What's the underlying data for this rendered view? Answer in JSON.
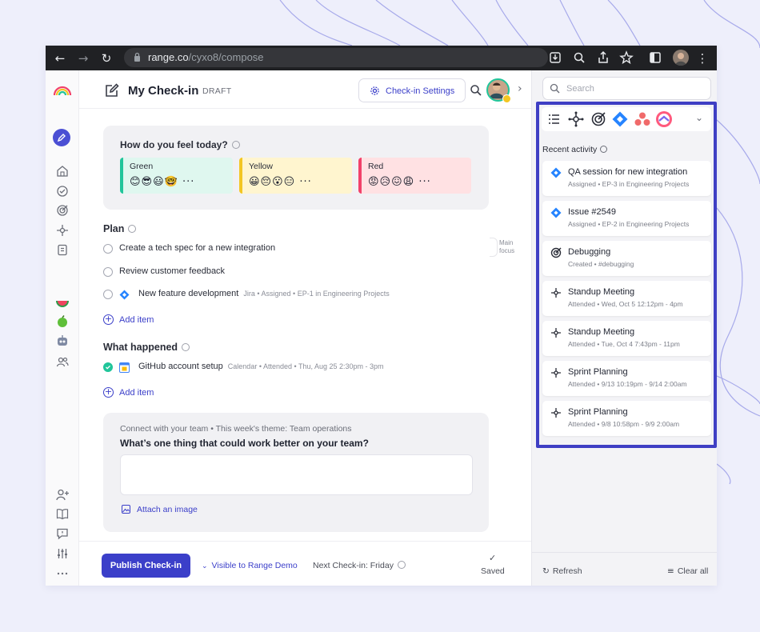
{
  "browser": {
    "url_host": "range.co",
    "url_path": "/cyxo8/compose"
  },
  "header": {
    "title": "My Check-in",
    "status": "DRAFT",
    "settings_label": "Check-in Settings"
  },
  "mood": {
    "question": "How do you feel today?",
    "options": [
      {
        "label": "Green",
        "emojis": "😊😎😃🤓 ···",
        "bg": "#dff7ef",
        "accent": "#21c59a"
      },
      {
        "label": "Yellow",
        "emojis": "😀😔😮😑 ···",
        "bg": "#fff5cf",
        "accent": "#f3c623"
      },
      {
        "label": "Red",
        "emojis": "😡😥😖😩 ···",
        "bg": "#ffe1e3",
        "accent": "#f2416a"
      }
    ]
  },
  "plan": {
    "heading": "Plan",
    "items": [
      {
        "text": "Create a tech spec for a new integration",
        "meta": ""
      },
      {
        "text": "Review customer feedback",
        "meta": ""
      },
      {
        "text": "New feature development",
        "meta": "Jira • Assigned • EP-1 in Engineering Projects"
      }
    ],
    "add_label": "Add item",
    "main_focus_label": "Main focus"
  },
  "happened": {
    "heading": "What happened",
    "items": [
      {
        "text": "GitHub account setup",
        "meta": "Calendar • Attended • Thu, Aug 25 2:30pm - 3pm"
      }
    ],
    "add_label": "Add item"
  },
  "team": {
    "subtitle": "Connect with your team • This week's theme: Team operations",
    "question": "What’s one thing that could work better on your team?",
    "answer": "",
    "attach_label": "Attach an image"
  },
  "footer": {
    "publish_label": "Publish Check-in",
    "visibility_label": "Visible to Range Demo",
    "next_label": "Next Check-in: Friday",
    "saved_label": "Saved"
  },
  "sidebar": {
    "search_placeholder": "Search",
    "recent_heading": "Recent activity",
    "activities": [
      {
        "title": "QA session for new integration",
        "subtitle": "Assigned • EP-3 in Engineering Projects",
        "icon": "jira-icon"
      },
      {
        "title": "Issue #2549",
        "subtitle": "Assigned • EP-2 in Engineering Projects",
        "icon": "jira-icon"
      },
      {
        "title": "Debugging",
        "subtitle": "Created • #debugging",
        "icon": "target-icon"
      },
      {
        "title": "Standup Meeting",
        "subtitle": "Attended • Wed, Oct 5 12:12pm - 4pm",
        "icon": "calendar-nodes-icon"
      },
      {
        "title": "Standup Meeting",
        "subtitle": "Attended • Tue, Oct 4 7:43pm - 11pm",
        "icon": "calendar-nodes-icon"
      },
      {
        "title": "Sprint Planning",
        "subtitle": "Attended • 9/13 10:19pm - 9/14 2:00am",
        "icon": "calendar-nodes-icon"
      },
      {
        "title": "Sprint Planning",
        "subtitle": "Attended • 9/8 10:58pm - 9/9 2:00am",
        "icon": "calendar-nodes-icon"
      }
    ],
    "refresh_label": "Refresh",
    "clear_label": "Clear all"
  },
  "colors": {
    "brand": "#3b3fc9",
    "highlight": "#3f3fc4"
  }
}
